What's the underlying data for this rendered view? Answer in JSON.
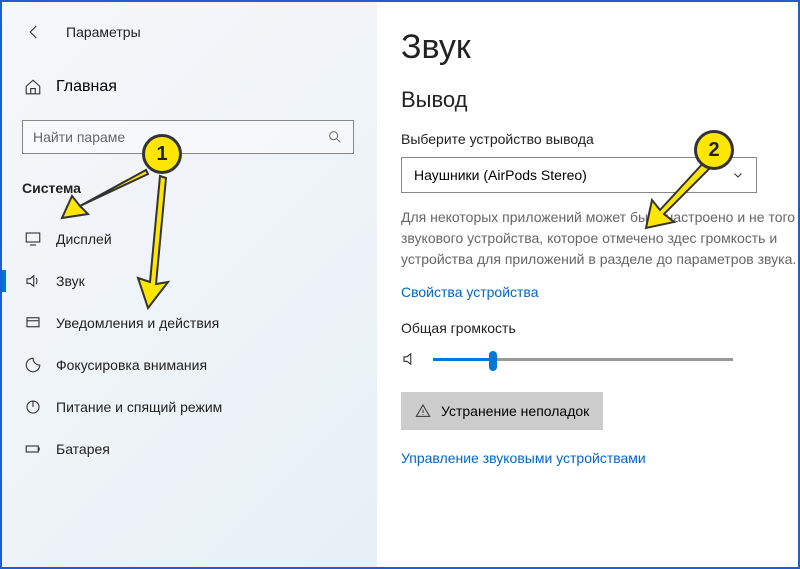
{
  "header": {
    "title": "Параметры"
  },
  "home": {
    "label": "Главная"
  },
  "search": {
    "placeholder": "Найти параме"
  },
  "section": {
    "title": "Система"
  },
  "nav": {
    "items": [
      {
        "icon": "display-icon",
        "label": "Дисплей"
      },
      {
        "icon": "sound-icon",
        "label": "Звук"
      },
      {
        "icon": "notify-icon",
        "label": "Уведомления и действия"
      },
      {
        "icon": "focus-icon",
        "label": "Фокусировка внимания"
      },
      {
        "icon": "power-icon",
        "label": "Питание и спящий режим"
      },
      {
        "icon": "battery-icon",
        "label": "Батарея"
      }
    ]
  },
  "main": {
    "title": "Звук",
    "output_heading": "Вывод",
    "output_device_label": "Выберите устройство вывода",
    "dropdown_value": "Наушники (AirPods Stereo)",
    "description": "Для некоторых приложений может быть настроено и не того звукового устройства, которое отмечено здес громкость и устройства для приложений в разделе до параметров звука.",
    "device_props_link": "Свойства устройства",
    "volume_label": "Общая громкость",
    "troubleshoot_btn": "Устранение неполадок",
    "manage_devices_link": "Управление звуковыми устройствами"
  },
  "annotations": {
    "badge1": "1",
    "badge2": "2"
  }
}
